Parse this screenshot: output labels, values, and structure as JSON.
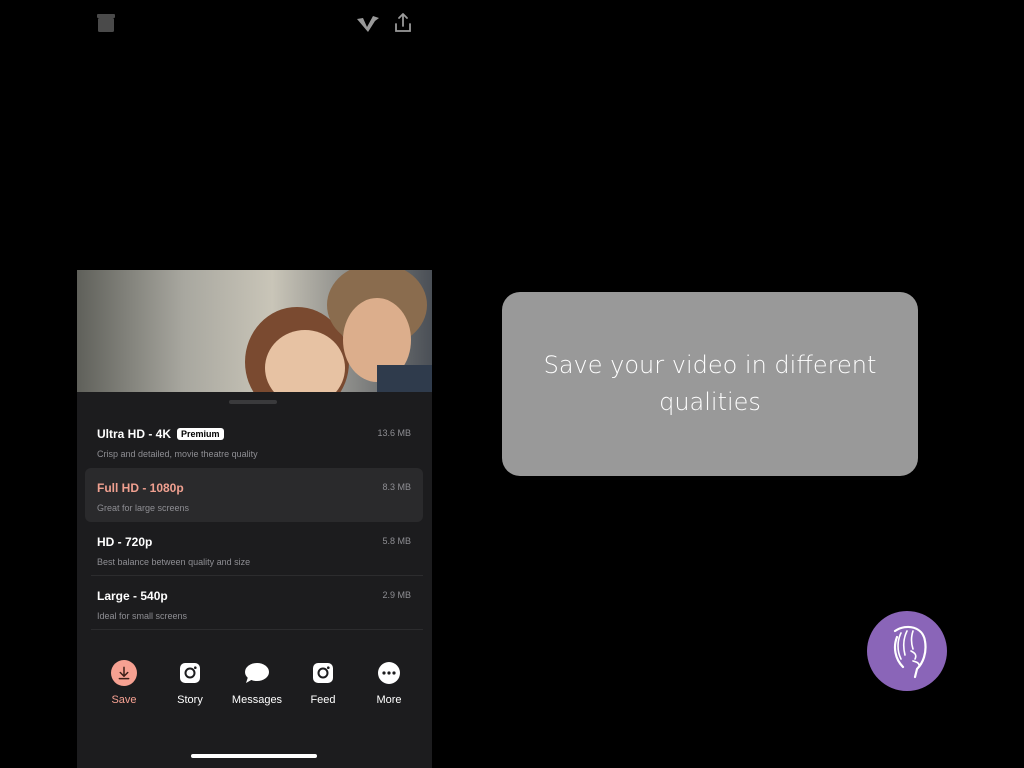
{
  "qualities": [
    {
      "title": "Ultra HD - 4K",
      "badge": "Premium",
      "subtitle": "Crisp and detailed, movie theatre quality",
      "size": "13.6 MB",
      "selected": false
    },
    {
      "title": "Full HD - 1080p",
      "subtitle": "Great for large screens",
      "size": "8.3 MB",
      "selected": true
    },
    {
      "title": "HD - 720p",
      "subtitle": "Best balance between quality and size",
      "size": "5.8 MB",
      "selected": false
    },
    {
      "title": "Large - 540p",
      "subtitle": "Ideal for small screens",
      "size": "2.9 MB",
      "selected": false
    }
  ],
  "actions": [
    {
      "label": "Save",
      "icon": "download-icon"
    },
    {
      "label": "Story",
      "icon": "instagram-icon"
    },
    {
      "label": "Messages",
      "icon": "message-bubble-icon"
    },
    {
      "label": "Feed",
      "icon": "instagram-icon"
    },
    {
      "label": "More",
      "icon": "more-dots-icon"
    }
  ],
  "tooltip": {
    "text": "Save your video in different qualities"
  },
  "colors": {
    "selected_text": "#f0a090",
    "save_accent": "#f6a192",
    "help_button": "#8a65b8",
    "tooltip_bg": "#999999"
  }
}
